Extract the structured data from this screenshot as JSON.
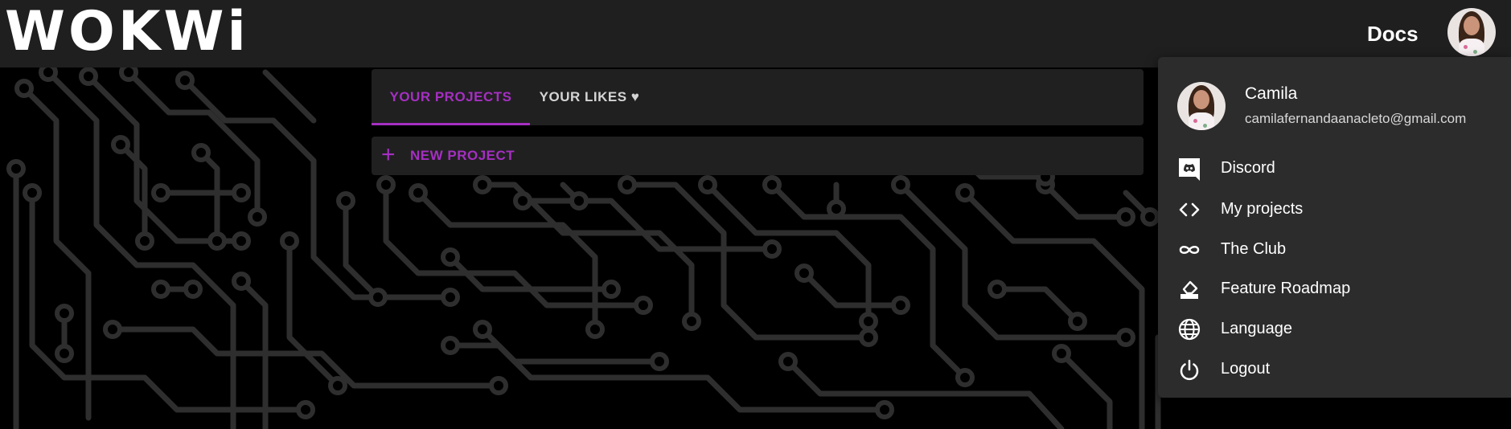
{
  "header": {
    "logo": "WOKWi",
    "docs_label": "Docs"
  },
  "tabs": [
    {
      "label": "YOUR PROJECTS",
      "active": true
    },
    {
      "label": "YOUR LIKES ♥",
      "active": false
    }
  ],
  "new_project": {
    "icon": "+",
    "label": "NEW PROJECT"
  },
  "user_menu": {
    "name": "Camila",
    "email": "camilafernandaanacleto@gmail.com",
    "items": [
      {
        "label": "Discord",
        "icon": "discord-icon"
      },
      {
        "label": "My projects",
        "icon": "code-icon"
      },
      {
        "label": "The Club",
        "icon": "infinity-icon"
      },
      {
        "label": "Feature Roadmap",
        "icon": "roadmap-icon"
      },
      {
        "label": "Language",
        "icon": "globe-icon"
      },
      {
        "label": "Logout",
        "icon": "power-icon"
      }
    ]
  },
  "colors": {
    "accent": "#a52fc2",
    "topbar": "#1f1f1f",
    "panel": "#202020",
    "menu": "#2c2c2c",
    "circuit": "#2e2e2e"
  }
}
